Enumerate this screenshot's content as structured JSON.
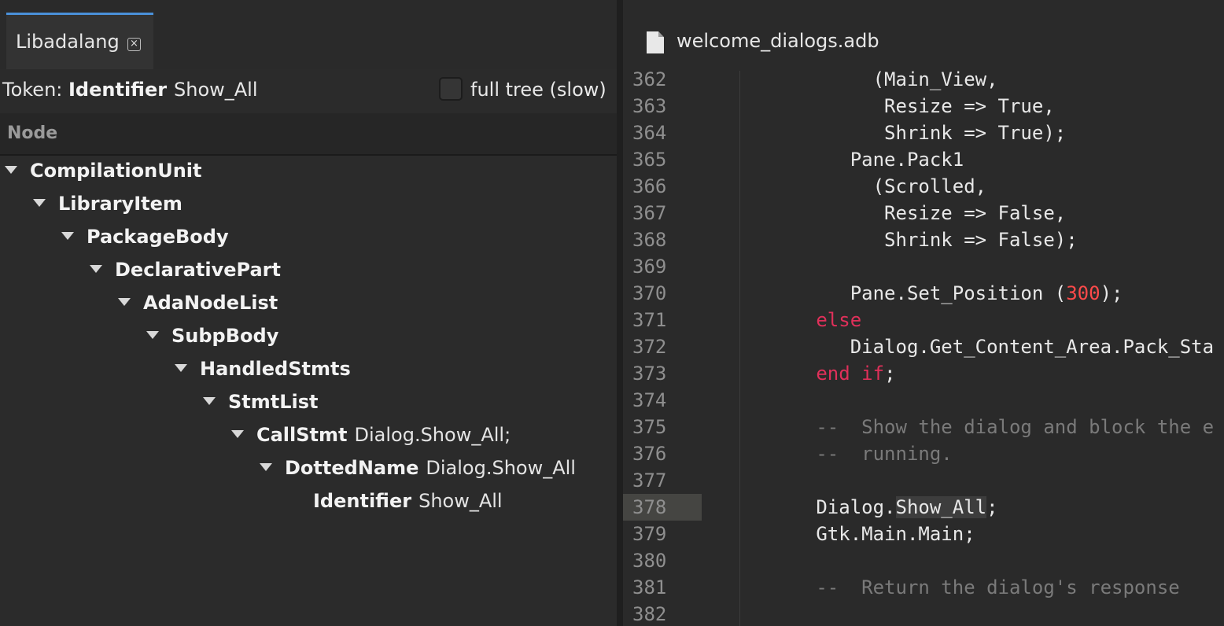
{
  "left_panel": {
    "tab": {
      "label": "Libadalang",
      "close_glyph": "×"
    },
    "token": {
      "prefix": "Token:",
      "kind": "Identifier",
      "name": "Show_All"
    },
    "full_tree": {
      "label": "full tree (slow)",
      "checked": false
    },
    "column_header": "Node",
    "tree": [
      {
        "kind": "CompilationUnit",
        "detail": "",
        "depth": 0,
        "expanded": true
      },
      {
        "kind": "LibraryItem",
        "detail": "",
        "depth": 1,
        "expanded": true
      },
      {
        "kind": "PackageBody",
        "detail": "",
        "depth": 2,
        "expanded": true
      },
      {
        "kind": "DeclarativePart",
        "detail": "",
        "depth": 3,
        "expanded": true
      },
      {
        "kind": "AdaNodeList",
        "detail": "",
        "depth": 4,
        "expanded": true
      },
      {
        "kind": "SubpBody",
        "detail": "",
        "depth": 5,
        "expanded": true
      },
      {
        "kind": "HandledStmts",
        "detail": "",
        "depth": 6,
        "expanded": true
      },
      {
        "kind": "StmtList",
        "detail": "",
        "depth": 7,
        "expanded": true
      },
      {
        "kind": "CallStmt",
        "detail": "Dialog.Show_All;",
        "depth": 8,
        "expanded": true
      },
      {
        "kind": "DottedName",
        "detail": "Dialog.Show_All",
        "depth": 9,
        "expanded": true
      },
      {
        "kind": "Identifier",
        "detail": "Show_All",
        "depth": 10,
        "expanded": false
      }
    ]
  },
  "editor": {
    "file_icon": "file-icon",
    "file_name": "welcome_dialogs.adb",
    "current_line": 378,
    "lines": [
      {
        "n": "362",
        "tokens": [
          {
            "t": "        (Main_View,",
            "k": ""
          }
        ]
      },
      {
        "n": "363",
        "tokens": [
          {
            "t": "         Resize => True,",
            "k": ""
          }
        ]
      },
      {
        "n": "364",
        "tokens": [
          {
            "t": "         Shrink => True);",
            "k": ""
          }
        ]
      },
      {
        "n": "365",
        "tokens": [
          {
            "t": "      Pane.Pack1",
            "k": ""
          }
        ]
      },
      {
        "n": "366",
        "tokens": [
          {
            "t": "        (Scrolled,",
            "k": ""
          }
        ]
      },
      {
        "n": "367",
        "tokens": [
          {
            "t": "         Resize => False,",
            "k": ""
          }
        ]
      },
      {
        "n": "368",
        "tokens": [
          {
            "t": "         Shrink => False);",
            "k": ""
          }
        ]
      },
      {
        "n": "369",
        "tokens": []
      },
      {
        "n": "370",
        "tokens": [
          {
            "t": "      Pane.Set_Position (",
            "k": ""
          },
          {
            "t": "300",
            "k": "num"
          },
          {
            "t": ");",
            "k": ""
          }
        ]
      },
      {
        "n": "371",
        "tokens": [
          {
            "t": "   ",
            "k": ""
          },
          {
            "t": "else",
            "k": "kw"
          }
        ]
      },
      {
        "n": "372",
        "tokens": [
          {
            "t": "      Dialog.Get_Content_Area.Pack_Sta",
            "k": ""
          }
        ]
      },
      {
        "n": "373",
        "tokens": [
          {
            "t": "   ",
            "k": ""
          },
          {
            "t": "end if",
            "k": "kw"
          },
          {
            "t": ";",
            "k": ""
          }
        ]
      },
      {
        "n": "374",
        "tokens": []
      },
      {
        "n": "375",
        "tokens": [
          {
            "t": "   --  Show the dialog and block the e",
            "k": "cmt"
          }
        ]
      },
      {
        "n": "376",
        "tokens": [
          {
            "t": "   --  running.",
            "k": "cmt"
          }
        ]
      },
      {
        "n": "377",
        "tokens": []
      },
      {
        "n": "378",
        "tokens": [
          {
            "t": "   Dialog.",
            "k": ""
          },
          {
            "t": "Show_All",
            "k": "hl"
          },
          {
            "t": ";",
            "k": ""
          }
        ]
      },
      {
        "n": "379",
        "tokens": [
          {
            "t": "   Gtk.Main.Main;",
            "k": ""
          }
        ]
      },
      {
        "n": "380",
        "tokens": []
      },
      {
        "n": "381",
        "tokens": [
          {
            "t": "   --  Return the dialog's response",
            "k": "cmt"
          }
        ]
      },
      {
        "n": "382",
        "tokens": []
      }
    ]
  },
  "colors": {
    "background": "#2a2a2a",
    "accent_tab": "#4a90d9",
    "keyword": "#e0305a",
    "number": "#ff4a4a",
    "comment": "#7a7a7a",
    "line_number": "#8f8f8f",
    "current_line_gutter": "#454542",
    "highlight": "#3d3d3d"
  }
}
